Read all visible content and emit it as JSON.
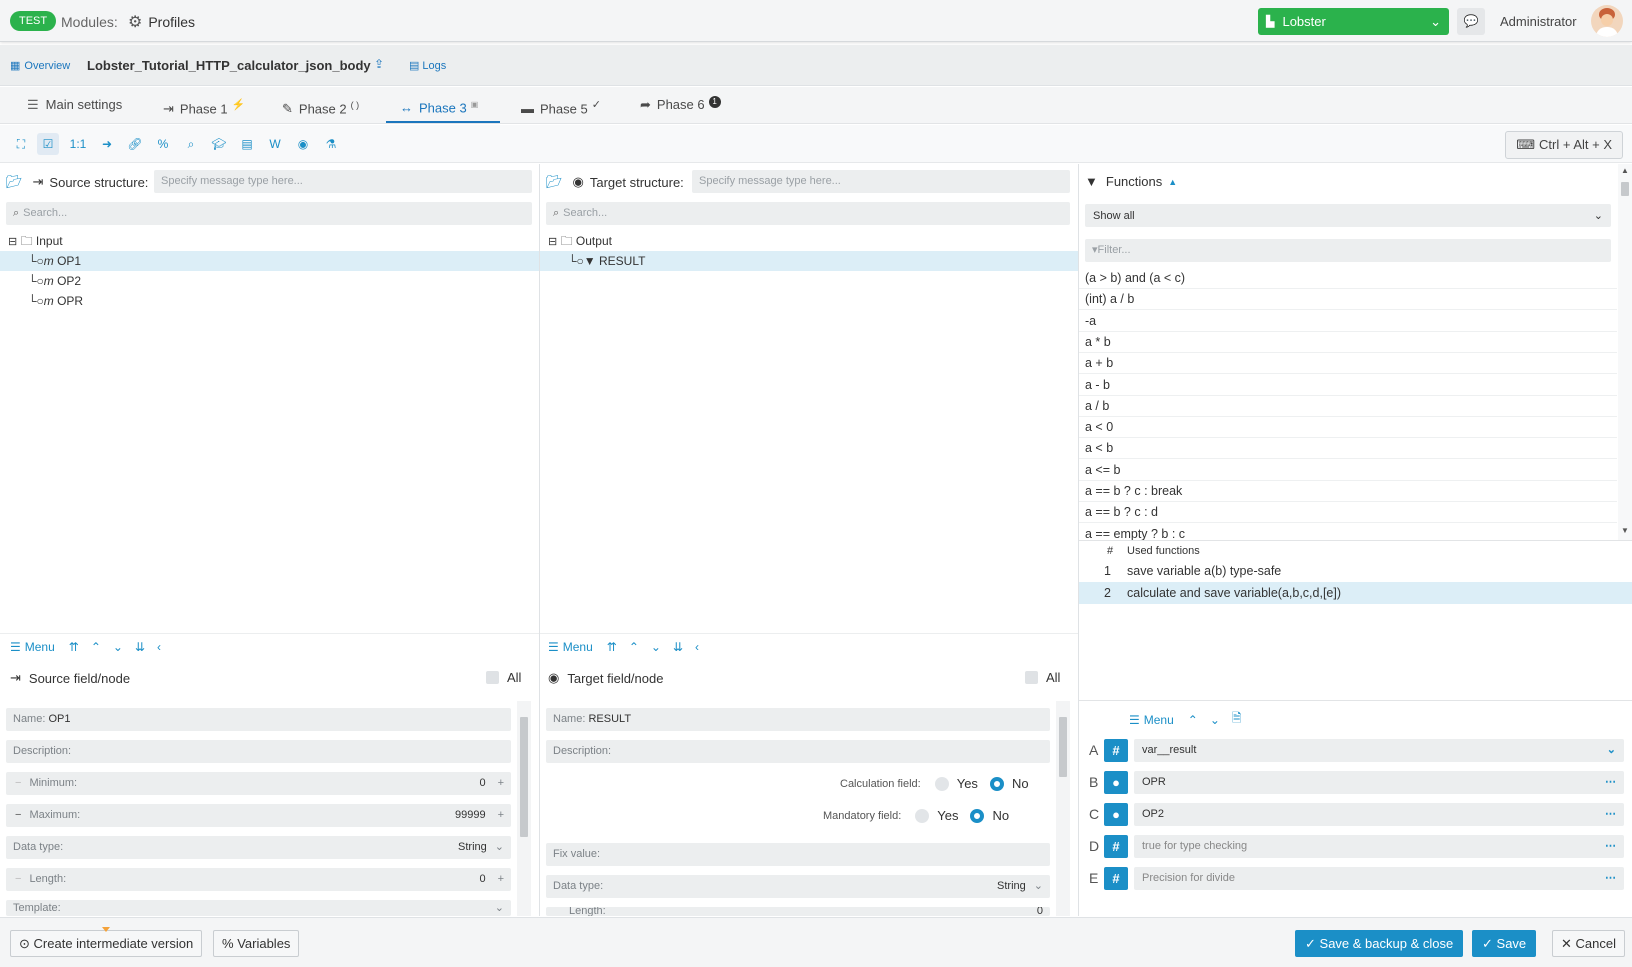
{
  "topbar": {
    "env_badge": "TEST",
    "modules_label": "Modules:",
    "profiles_label": "Profiles",
    "instance_select": "Lobster",
    "user_name": "Administrator",
    "brand_color": "#2bb24c"
  },
  "breadcrumb": {
    "overview": "Overview",
    "profile_name": "Lobster_Tutorial_HTTP_calculator_json_body",
    "logs": "Logs"
  },
  "tabs": [
    {
      "label": "Main settings",
      "icon": "list-icon"
    },
    {
      "label": "Phase 1",
      "icon": "import-icon",
      "suffix": "⚡"
    },
    {
      "label": "Phase 2",
      "icon": "edit-icon",
      "suffix": "( )"
    },
    {
      "label": "Phase 3",
      "icon": "arrows-icon",
      "active": true
    },
    {
      "label": "Phase 5",
      "icon": "server-icon",
      "suffix": "✓"
    },
    {
      "label": "Phase 6",
      "icon": "share-icon",
      "suffix": "1"
    }
  ],
  "toolbar": {
    "one_to_one": "1:1",
    "shortcut": "Ctrl + Alt + X"
  },
  "source": {
    "title": "Source structure:",
    "type_placeholder": "Specify message type here...",
    "search_placeholder": "Search...",
    "root": "Input",
    "nodes": [
      "OP1",
      "OP2",
      "OPR"
    ]
  },
  "target": {
    "title": "Target structure:",
    "type_placeholder": "Specify message type here...",
    "search_placeholder": "Search...",
    "root": "Output",
    "nodes": [
      "RESULT"
    ]
  },
  "functions": {
    "title": "Functions",
    "filter_select": "Show all",
    "filter_placeholder": "Filter...",
    "list": [
      "(a > b) and (a < c)",
      "(int) a / b",
      "-a",
      "a * b",
      "a + b",
      "a - b",
      "a / b",
      "a < 0",
      "a < b",
      "a <= b",
      "a == b ? c : break",
      "a == b ? c : d",
      "a == empty ? b : c"
    ],
    "used_header_num": "#",
    "used_header": "Used functions",
    "used": [
      {
        "num": "1",
        "name": "save variable a(b) type-safe"
      },
      {
        "num": "2",
        "name": "calculate and save variable(a,b,c,d,[e])"
      }
    ]
  },
  "menu_label": "Menu",
  "source_node": {
    "title": "Source field/node",
    "all": "All",
    "name_label": "Name:",
    "name_value": "OP1",
    "description_label": "Description:",
    "minimum_label": "Minimum:",
    "minimum_value": "0",
    "maximum_label": "Maximum:",
    "maximum_value": "99999",
    "data_type_label": "Data type:",
    "data_type_value": "String",
    "length_label": "Length:",
    "length_value": "0",
    "template_label": "Template:"
  },
  "target_node": {
    "title": "Target field/node",
    "all": "All",
    "name_label": "Name:",
    "name_value": "RESULT",
    "description_label": "Description:",
    "calc_label": "Calculation field:",
    "mandatory_label": "Mandatory field:",
    "yes": "Yes",
    "no": "No",
    "fix_label": "Fix value:",
    "data_type_label": "Data type:",
    "data_type_value": "String",
    "length_label": "Length:",
    "length_value": "0"
  },
  "params": [
    {
      "letter": "A",
      "type": "#",
      "value": "var__result"
    },
    {
      "letter": "B",
      "type": "●",
      "value": "OPR"
    },
    {
      "letter": "C",
      "type": "●",
      "value": "OP2"
    },
    {
      "letter": "D",
      "type": "#",
      "value": "true for type checking"
    },
    {
      "letter": "E",
      "type": "#",
      "value": "Precision for divide"
    }
  ],
  "footer": {
    "create_version": "Create intermediate version",
    "variables": "Variables",
    "save_backup_close": "Save & backup & close",
    "save": "Save",
    "cancel": "Cancel"
  },
  "colors": {
    "accent": "#1b8fc7",
    "highlight": "#dceef7"
  }
}
